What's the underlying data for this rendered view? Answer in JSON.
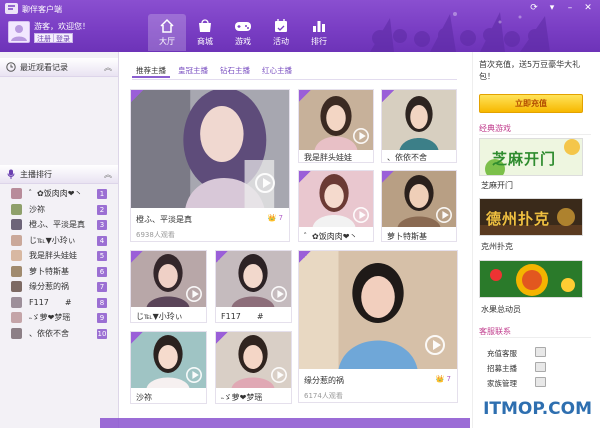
{
  "app": {
    "title": "聊伴客户端"
  },
  "user": {
    "greeting": "游客，欢迎您！",
    "register_label": "注册",
    "login_label": "登录"
  },
  "nav": [
    {
      "label": "大厅",
      "icon": "home-icon",
      "active": true
    },
    {
      "label": "商城",
      "icon": "shop-icon",
      "active": false
    },
    {
      "label": "游戏",
      "icon": "gamepad-icon",
      "active": false
    },
    {
      "label": "活动",
      "icon": "calendar-icon",
      "active": false
    },
    {
      "label": "排行",
      "icon": "bar-chart-icon",
      "active": false
    }
  ],
  "sidebar": {
    "recent_title": "最近观看记录",
    "rank_title": "主播排行",
    "rank": [
      {
        "name": "゛✿饭肉肉❤丶",
        "num": "1"
      },
      {
        "name": "沙祢",
        "num": "2"
      },
      {
        "name": "橙ふ、平淡是真",
        "num": "3"
      },
      {
        "name": "じ℡▼小玲ぃ",
        "num": "4"
      },
      {
        "name": "我是胖头娃娃",
        "num": "5"
      },
      {
        "name": "萝卜特斯基",
        "num": "6"
      },
      {
        "name": "缘分惹的祸",
        "num": "7"
      },
      {
        "name": "F117　　#",
        "num": "8"
      },
      {
        "name": "˵ゞ萝❤梦瑶",
        "num": "9"
      },
      {
        "name": "、依依不舍",
        "num": "10"
      }
    ]
  },
  "tabs": [
    "推荐主播",
    "皇冠主播",
    "钻石主播",
    "红心主播"
  ],
  "cards": [
    {
      "name": "橙ふ、平淡是真",
      "viewers": "6938人观看",
      "rating": "7"
    },
    {
      "name": "我是胖头娃娃"
    },
    {
      "name": "、依依不舍"
    },
    {
      "name": "゛✿饭肉肉❤丶"
    },
    {
      "name": "萝卜特斯基"
    },
    {
      "name": "じ℡▼小玲ぃ"
    },
    {
      "name": "F117　　#"
    },
    {
      "name": "缘分惹的祸",
      "viewers": "6174人观看",
      "rating": "7"
    },
    {
      "name": "沙祢"
    },
    {
      "name": "˵ゞ萝❤梦瑶"
    }
  ],
  "right": {
    "promo": "首次充值，送5万豆豪华大礼包！",
    "recharge_label": "立即充值",
    "games_title": "经典游戏",
    "games": [
      {
        "banner": "芝麻开门",
        "name": "芝麻开门"
      },
      {
        "banner": "德州扑克",
        "name": "克州扑克"
      },
      {
        "banner": "",
        "name": "水果总动员"
      }
    ],
    "cs_title": "客服联系",
    "cs": [
      "充值客服",
      "招募主播",
      "家族管理"
    ]
  },
  "watermark": "ITMOP.COM",
  "colors": {
    "brand": "#7a3ec4",
    "accent": "#8b5fd0",
    "badge": "#9b6fd3"
  }
}
